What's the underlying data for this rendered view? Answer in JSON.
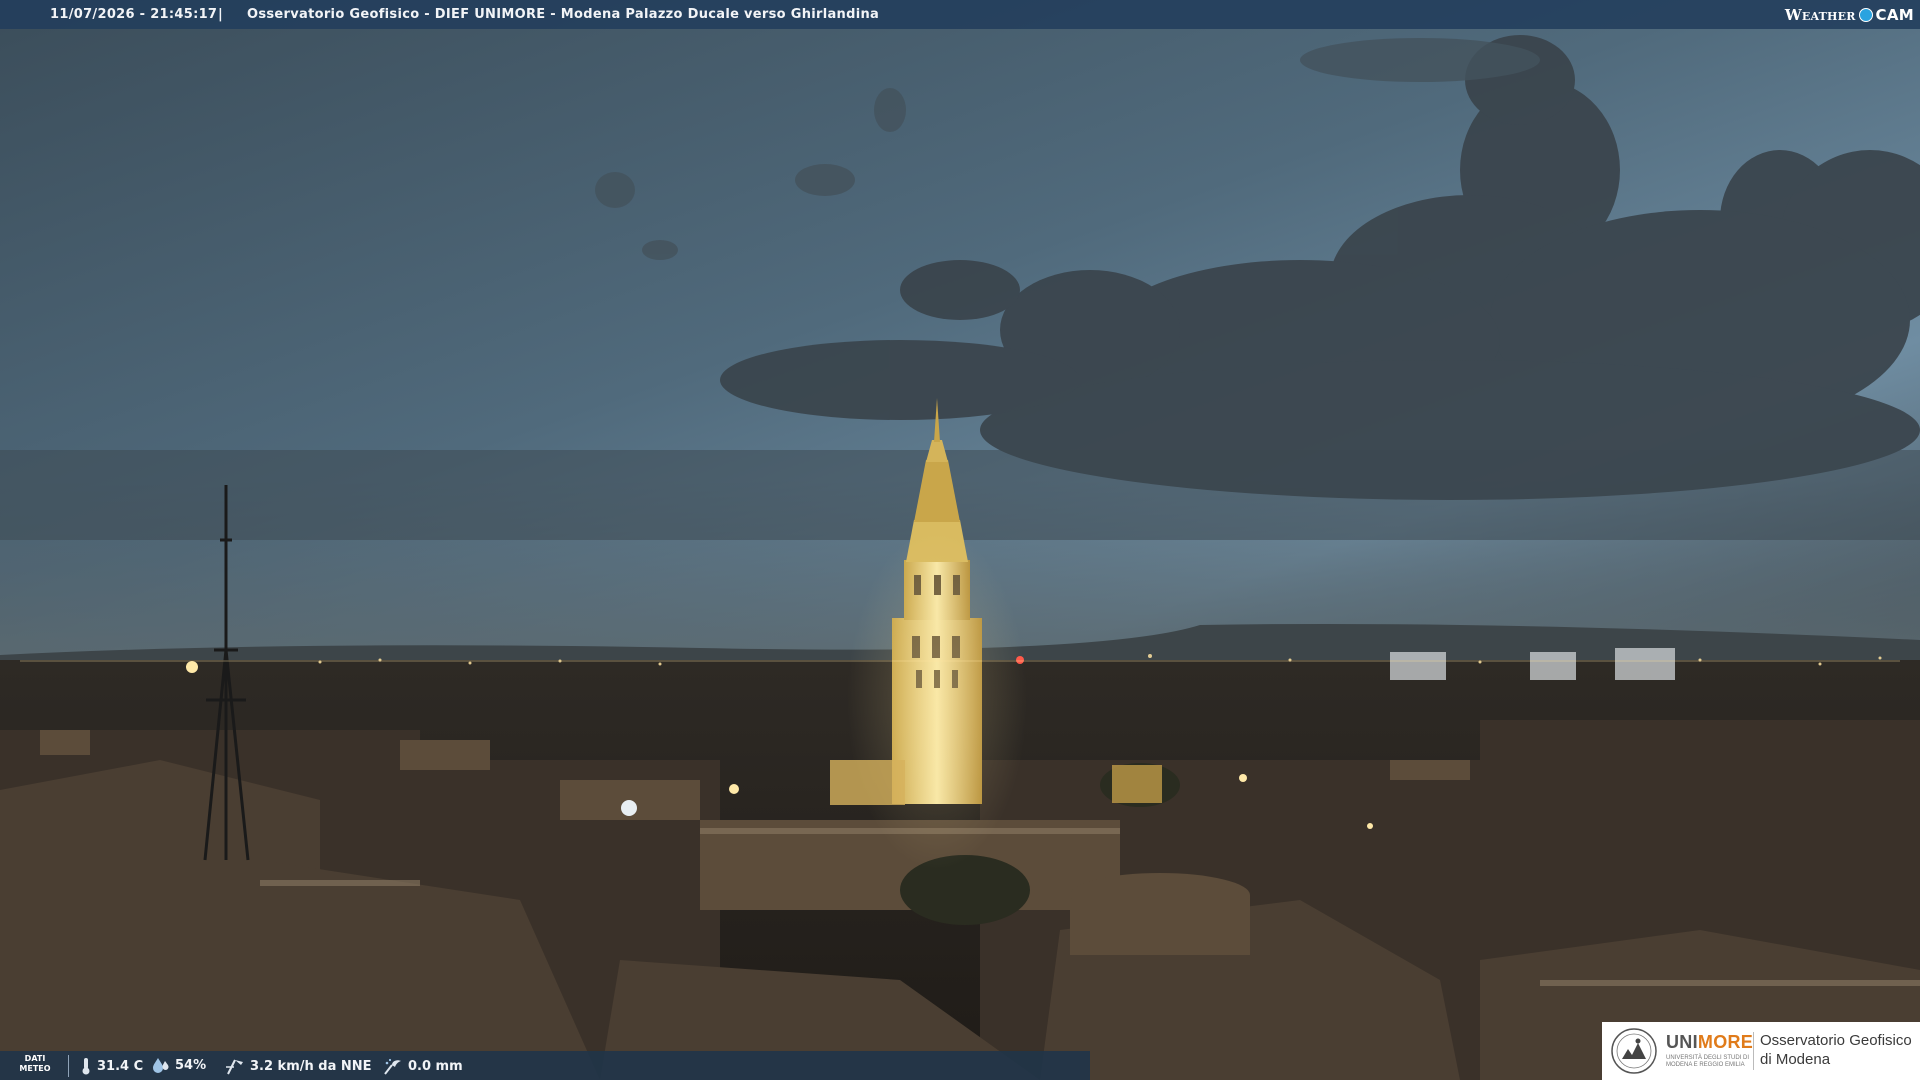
{
  "header": {
    "timestamp": "11/07/2026 - 21:45:17",
    "separator": "|",
    "caption": "Osservatorio Geofisico - DIEF UNIMORE - Modena Palazzo Ducale verso Ghirlandina",
    "brand_weather": "Weather",
    "brand_cam": "CAM",
    "brand_dot_color": "#2aa3e0"
  },
  "meteo": {
    "label_line1": "DATI",
    "label_line2": "METEO",
    "temperature": "31.4 C",
    "temperature_icon": "thermometer-icon",
    "humidity": "54%",
    "humidity_icon": "humidity-drop-icon",
    "wind": "3.2 km/h da NNE",
    "wind_icon": "wind-icon",
    "rain": "0.0 mm",
    "rain_icon": "rain-icon"
  },
  "logo": {
    "uni_part1": "UNI",
    "uni_part2": "MORE",
    "uni_subtitle": "UNIVERSITÀ DEGLI STUDI DI MODENA E REGGIO EMILIA",
    "observatory_line1": "Osservatorio Geofisico",
    "observatory_line2": "di Modena",
    "accent_color": "#e07b1a"
  }
}
